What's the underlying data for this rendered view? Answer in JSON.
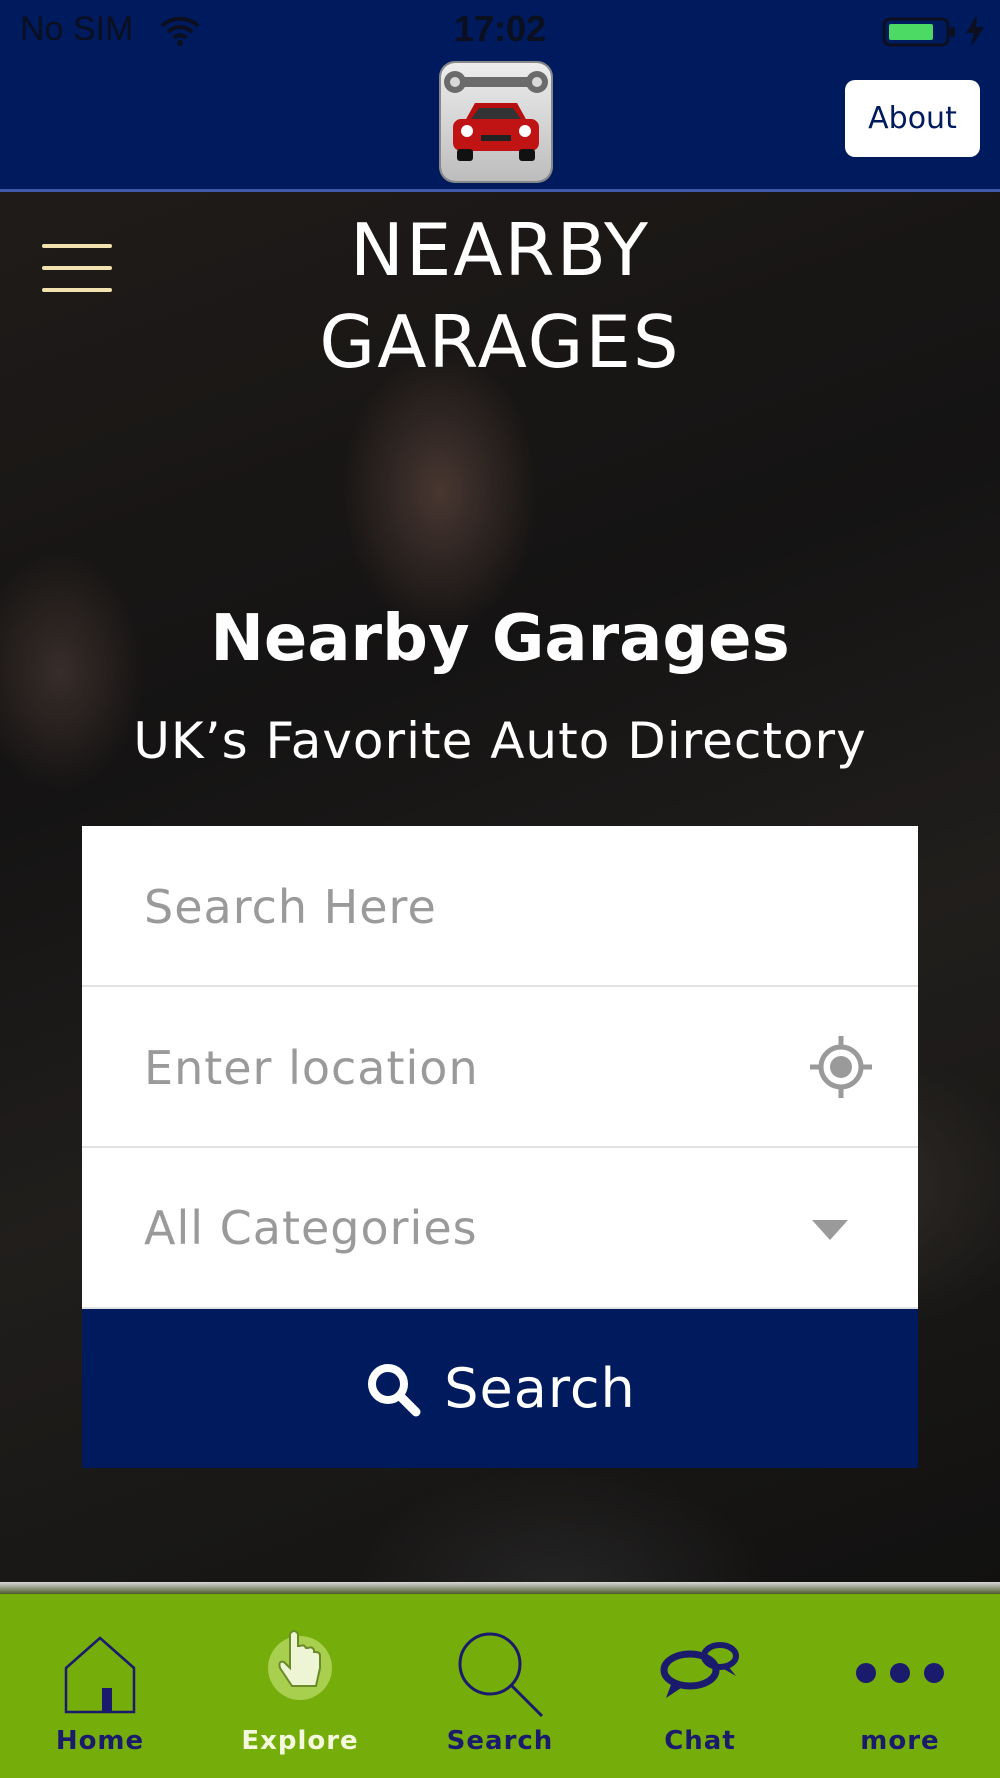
{
  "status_bar": {
    "carrier": "No SIM",
    "time": "17:02"
  },
  "header": {
    "about_label": "About"
  },
  "hero": {
    "title_line1": "NEARBY",
    "title_line2": "GARAGES",
    "heading": "Nearby Garages",
    "subtitle": "UK’s Favorite Auto Directory"
  },
  "search_form": {
    "search_placeholder": "Search Here",
    "location_placeholder": "Enter location",
    "category_selected": "All Categories",
    "search_button_label": "Search"
  },
  "bottom_nav": {
    "items": [
      {
        "label": "Home",
        "icon": "home-icon"
      },
      {
        "label": "Explore",
        "icon": "pointer-hand-icon",
        "active": true
      },
      {
        "label": "Search",
        "icon": "magnifier-icon"
      },
      {
        "label": "Chat",
        "icon": "chat-bubbles-icon"
      },
      {
        "label": "more",
        "icon": "more-dots-icon"
      }
    ]
  },
  "colors": {
    "header": "#001a5e",
    "nav": "#75ad0b",
    "button": "#001a5e"
  }
}
